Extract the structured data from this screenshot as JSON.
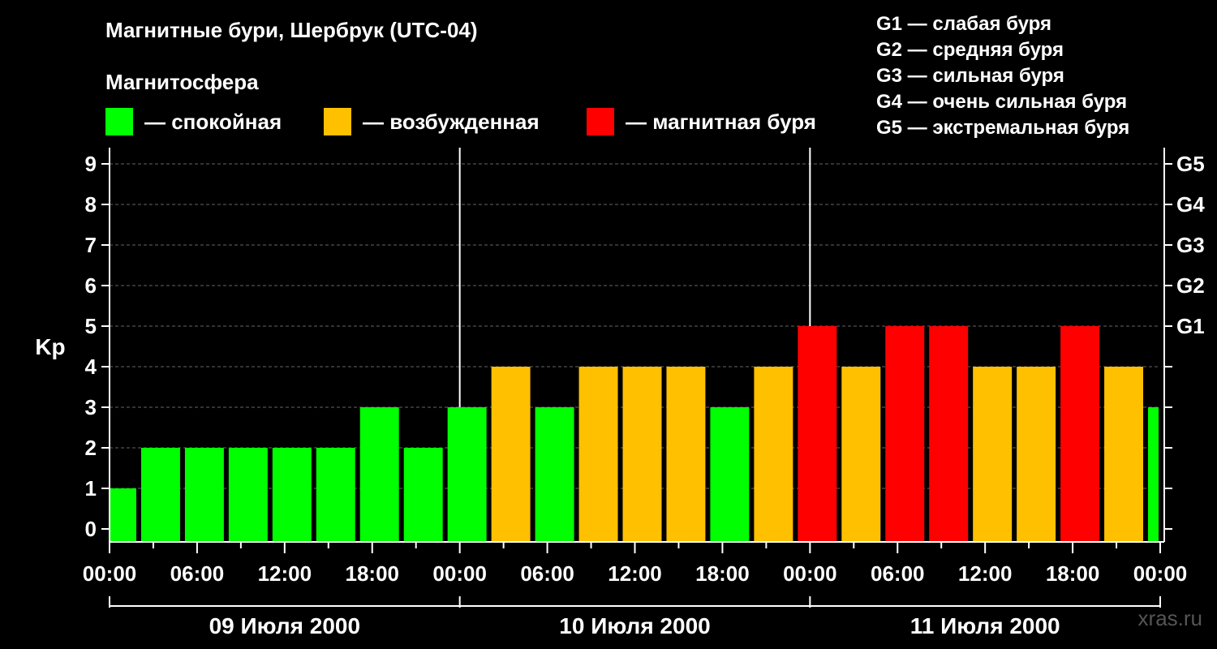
{
  "title": "Магнитные бури, Шербрук (UTC-04)",
  "magnetosphere_label": "Магнитосфера",
  "legend": [
    {
      "label": "— спокойная",
      "color": "#00ff00"
    },
    {
      "label": "— возбужденная",
      "color": "#ffc000"
    },
    {
      "label": "— магнитная буря",
      "color": "#ff0000"
    }
  ],
  "g_legend": [
    "G1 — слабая буря",
    "G2 — средняя буря",
    "G3 — сильная буря",
    "G4 — очень сильная буря",
    "G5 — экстремальная буря"
  ],
  "watermark": "xras.ru",
  "chart_data": {
    "type": "bar",
    "ylabel": "Kp",
    "ylim": [
      0,
      9
    ],
    "y_ticks": [
      "0",
      "1",
      "2",
      "3",
      "4",
      "5",
      "6",
      "7",
      "8",
      "9"
    ],
    "right_ticks": [
      {
        "kp": 5,
        "label": "G1"
      },
      {
        "kp": 6,
        "label": "G2"
      },
      {
        "kp": 7,
        "label": "G3"
      },
      {
        "kp": 8,
        "label": "G4"
      },
      {
        "kp": 9,
        "label": "G5"
      }
    ],
    "x_tick_labels": [
      "00:00",
      "06:00",
      "12:00",
      "18:00",
      "00:00",
      "06:00",
      "12:00",
      "18:00",
      "00:00",
      "06:00",
      "12:00",
      "18:00",
      "00:00"
    ],
    "days": [
      "09 Июля 2000",
      "10 Июля 2000",
      "11 Июля 2000"
    ],
    "grid": "dashed horizontal",
    "colors": {
      "quiet": "#00ff00",
      "active": "#ffc000",
      "storm": "#ff0000"
    },
    "series": [
      {
        "values": [
          1,
          2,
          2,
          2,
          2,
          2,
          3,
          2,
          3,
          4,
          3,
          4,
          4,
          4,
          3,
          4,
          5,
          4,
          5,
          5,
          4,
          4,
          5,
          4,
          3
        ]
      }
    ]
  }
}
